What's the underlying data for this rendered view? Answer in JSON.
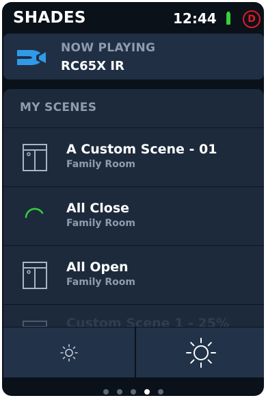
{
  "status_bar": {
    "title": "SHADES",
    "time": "12:44",
    "battery_icon": "battery-icon",
    "profile_initial": "D"
  },
  "now_playing": {
    "label": "NOW PLAYING",
    "source": "RC65X IR",
    "logo_icon": "directv-logo-icon"
  },
  "scenes": {
    "title": "MY SCENES",
    "items": [
      {
        "name": "A Custom Scene - 01",
        "room": "Family Room",
        "icon": "window-shade-icon"
      },
      {
        "name": "All Close",
        "room": "Family Room",
        "icon": "progress-arc-icon"
      },
      {
        "name": "All Open",
        "room": "Family Room",
        "icon": "window-shade-icon"
      },
      {
        "name": "Custom Scene 1 - 25%",
        "room": "",
        "icon": "window-shade-icon"
      }
    ]
  },
  "brightness": {
    "low_icon": "brightness-low-icon",
    "high_icon": "brightness-high-icon"
  },
  "pager": {
    "count": 5,
    "active_index": 3
  },
  "colors": {
    "background": "#0b1119",
    "card": "#202f44",
    "panel": "#1d2a3c",
    "accent_green": "#33d13a",
    "alert_red": "#e01b24",
    "logo_blue": "#2f9be8",
    "muted_text": "#8f9cb0"
  }
}
